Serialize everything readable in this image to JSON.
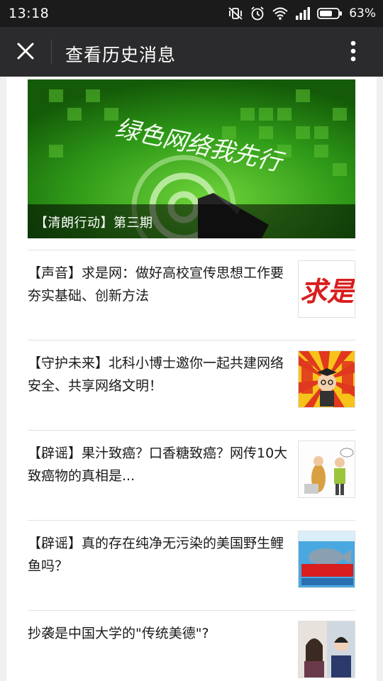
{
  "status_bar": {
    "time": "13:18",
    "battery": "63%"
  },
  "header": {
    "title": "查看历史消息",
    "close_icon": "close-icon",
    "more_icon": "more-vertical-icon"
  },
  "cover_article": {
    "caption": "【清朗行动】第三期",
    "art_text": "绿色网络我先行"
  },
  "articles": [
    {
      "title": "【声音】求是网：做好高校宣传思想工作要夯实基础、创新方法",
      "thumb_text": "求是"
    },
    {
      "title": "【守护未来】北科小博士邀你一起共建网络安全、共享网络文明！",
      "thumb_text": ""
    },
    {
      "title": "【辟谣】果汁致癌？口香糖致癌？网传10大致癌物的真相是...",
      "thumb_text": ""
    },
    {
      "title": "【辟谣】真的存在纯净无污染的美国野生鲤鱼吗？",
      "thumb_text": ""
    },
    {
      "title": "抄袭是中国大学的\"传统美德\"?",
      "thumb_text": ""
    }
  ],
  "colors": {
    "status_bg": "#1b1b1b",
    "header_bg": "#2b2b2d",
    "cover_green": "#2f8f14",
    "accent_red": "#d81e1e"
  }
}
